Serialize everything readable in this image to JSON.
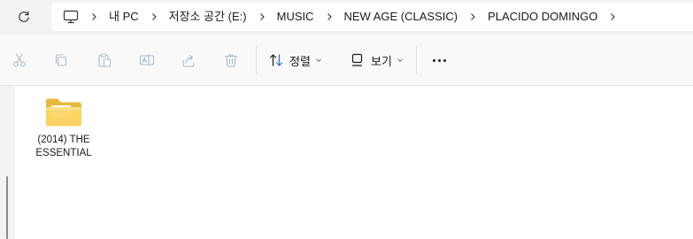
{
  "address_bar": {
    "refresh_icon": "refresh-icon",
    "pc_icon": "monitor-icon",
    "breadcrumbs": [
      "내 PC",
      "저장소 공간 (E:)",
      "MUSIC",
      "NEW AGE (CLASSIC)",
      "PLACIDO DOMINGO"
    ]
  },
  "command_bar": {
    "disabled_actions": [
      "cut-icon",
      "copy-icon",
      "paste-icon",
      "rename-icon",
      "share-icon",
      "delete-icon"
    ],
    "sort_label": "정렬",
    "view_label": "보기",
    "more_icon": "more-icon"
  },
  "content": {
    "items": [
      {
        "type": "folder",
        "label": "(2014) THE ESSENTIAL",
        "icon": "folder-icon"
      }
    ]
  }
}
